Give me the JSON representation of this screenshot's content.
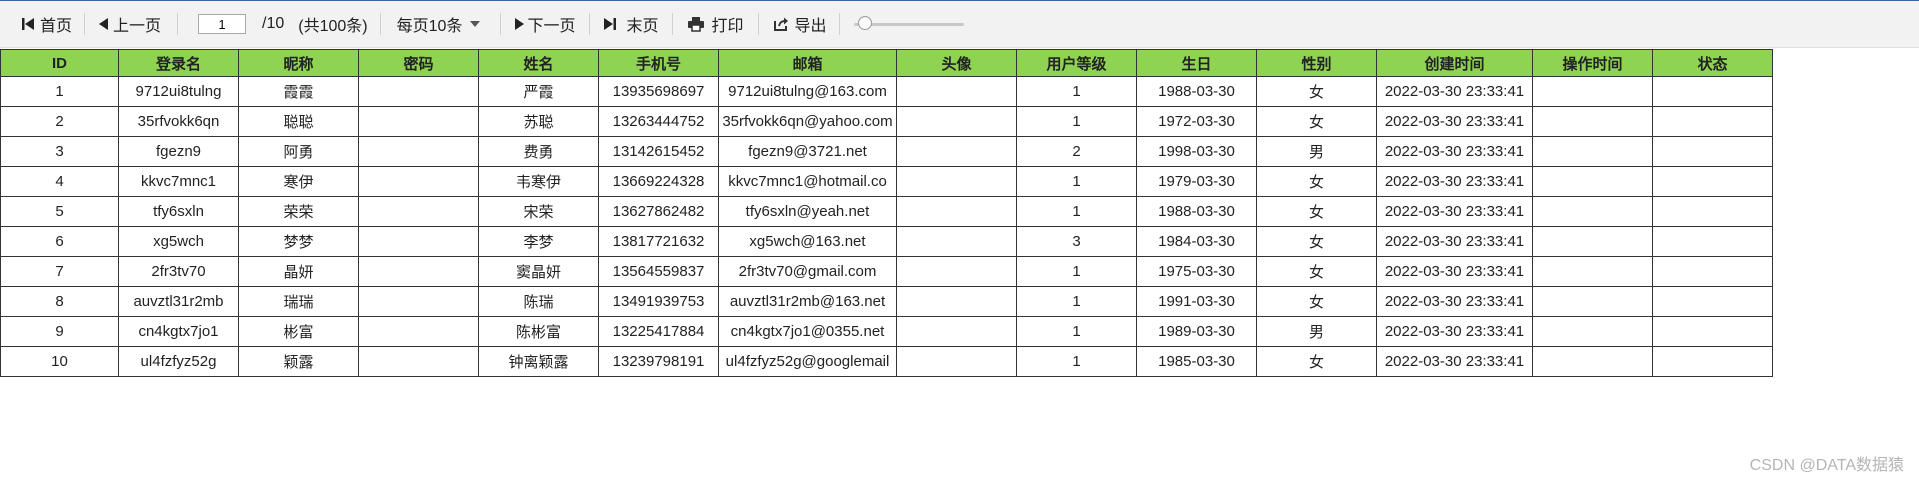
{
  "toolbar": {
    "first": "首页",
    "prev": "上一页",
    "page_value": "1",
    "page_total": "/10",
    "record_total": "(共100条)",
    "per_page": "每页10条",
    "next": "下一页",
    "last": "末页",
    "print": "打印",
    "export": "导出",
    "zoom_level": 0.05
  },
  "table": {
    "columns": [
      "ID",
      "登录名",
      "昵称",
      "密码",
      "姓名",
      "手机号",
      "邮箱",
      "头像",
      "用户等级",
      "生日",
      "性别",
      "创建时间",
      "操作时间",
      "状态"
    ],
    "rows": [
      [
        "1",
        "9712ui8tulng",
        "霞霞",
        "",
        "严霞",
        "13935698697",
        "9712ui8tulng@163.com",
        "",
        "1",
        "1988-03-30",
        "女",
        "2022-03-30 23:33:41",
        "",
        ""
      ],
      [
        "2",
        "35rfvokk6qn",
        "聪聪",
        "",
        "苏聪",
        "13263444752",
        "35rfvokk6qn@yahoo.com",
        "",
        "1",
        "1972-03-30",
        "女",
        "2022-03-30 23:33:41",
        "",
        ""
      ],
      [
        "3",
        "fgezn9",
        "阿勇",
        "",
        "费勇",
        "13142615452",
        "fgezn9@3721.net",
        "",
        "2",
        "1998-03-30",
        "男",
        "2022-03-30 23:33:41",
        "",
        ""
      ],
      [
        "4",
        "kkvc7mnc1",
        "寒伊",
        "",
        "韦寒伊",
        "13669224328",
        "kkvc7mnc1@hotmail.co",
        "",
        "1",
        "1979-03-30",
        "女",
        "2022-03-30 23:33:41",
        "",
        ""
      ],
      [
        "5",
        "tfy6sxln",
        "荣荣",
        "",
        "宋荣",
        "13627862482",
        "tfy6sxln@yeah.net",
        "",
        "1",
        "1988-03-30",
        "女",
        "2022-03-30 23:33:41",
        "",
        ""
      ],
      [
        "6",
        "xg5wch",
        "梦梦",
        "",
        "李梦",
        "13817721632",
        "xg5wch@163.net",
        "",
        "3",
        "1984-03-30",
        "女",
        "2022-03-30 23:33:41",
        "",
        ""
      ],
      [
        "7",
        "2fr3tv70",
        "晶妍",
        "",
        "窦晶妍",
        "13564559837",
        "2fr3tv70@gmail.com",
        "",
        "1",
        "1975-03-30",
        "女",
        "2022-03-30 23:33:41",
        "",
        ""
      ],
      [
        "8",
        "auvztl31r2mb",
        "瑞瑞",
        "",
        "陈瑞",
        "13491939753",
        "auvztl31r2mb@163.net",
        "",
        "1",
        "1991-03-30",
        "女",
        "2022-03-30 23:33:41",
        "",
        ""
      ],
      [
        "9",
        "cn4kgtx7jo1",
        "彬富",
        "",
        "陈彬富",
        "13225417884",
        "cn4kgtx7jo1@0355.net",
        "",
        "1",
        "1989-03-30",
        "男",
        "2022-03-30 23:33:41",
        "",
        ""
      ],
      [
        "10",
        "ul4fzfyz52g",
        "颖露",
        "",
        "钟离颖露",
        "13239798191",
        "ul4fzfyz52g@googlemail",
        "",
        "1",
        "1985-03-30",
        "女",
        "2022-03-30 23:33:41",
        "",
        ""
      ]
    ]
  },
  "watermark": "CSDN @DATA数据猿"
}
